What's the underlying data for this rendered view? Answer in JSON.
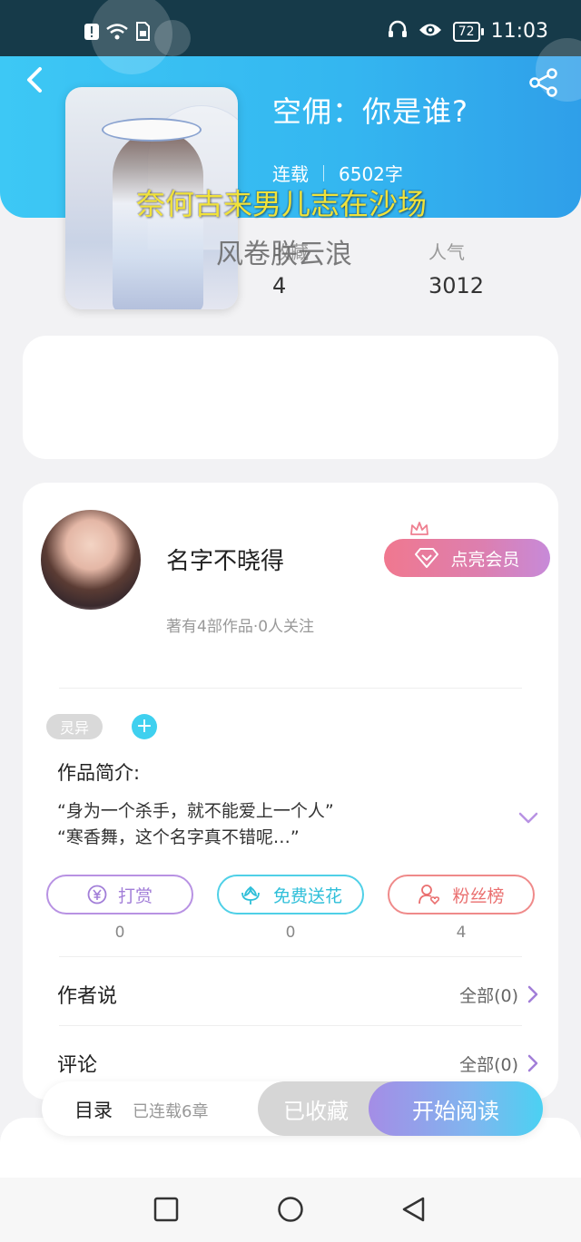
{
  "status_bar": {
    "time": "11:03",
    "battery": "72",
    "icons": [
      "alert-icon",
      "wifi-icon",
      "sim-icon",
      "headphones-icon",
      "eye-icon",
      "battery-icon"
    ]
  },
  "book": {
    "title": "空佣：你是谁?",
    "status": "连载",
    "word_count": "6502字",
    "collect_label": "收藏",
    "collect_value": "4",
    "popularity_label": "人气",
    "popularity_value": "3012"
  },
  "overlay": {
    "line1": "奈何古来男儿志在沙场",
    "line2": "风卷朕云浪"
  },
  "author": {
    "name": "名字不晓得",
    "subtitle": "著有4部作品·0人关注",
    "vip_label": "点亮会员"
  },
  "tags": [
    "灵异"
  ],
  "intro": {
    "title": "作品简介:",
    "line1": "“身为一个杀手，就不能爱上一个人”",
    "line2": "“寒香舞，这个名字真不错呢…”"
  },
  "actions": [
    {
      "label": "打赏",
      "count": "0"
    },
    {
      "label": "免费送花",
      "count": "0"
    },
    {
      "label": "粉丝榜",
      "count": "4"
    }
  ],
  "sections": {
    "author_says": "作者说",
    "author_says_more": "全部(0)",
    "comments": "评论",
    "comments_more": "全部(0)"
  },
  "bottom_bar": {
    "toc": "目录",
    "toc_sub": "已连载6章",
    "collected": "已收藏",
    "start_reading": "开始阅读"
  },
  "colors": {
    "header": "#34b6f0",
    "accent_purple": "#a27ed8",
    "accent_cyan": "#2fbfd9",
    "accent_red": "#ea6f6f"
  }
}
